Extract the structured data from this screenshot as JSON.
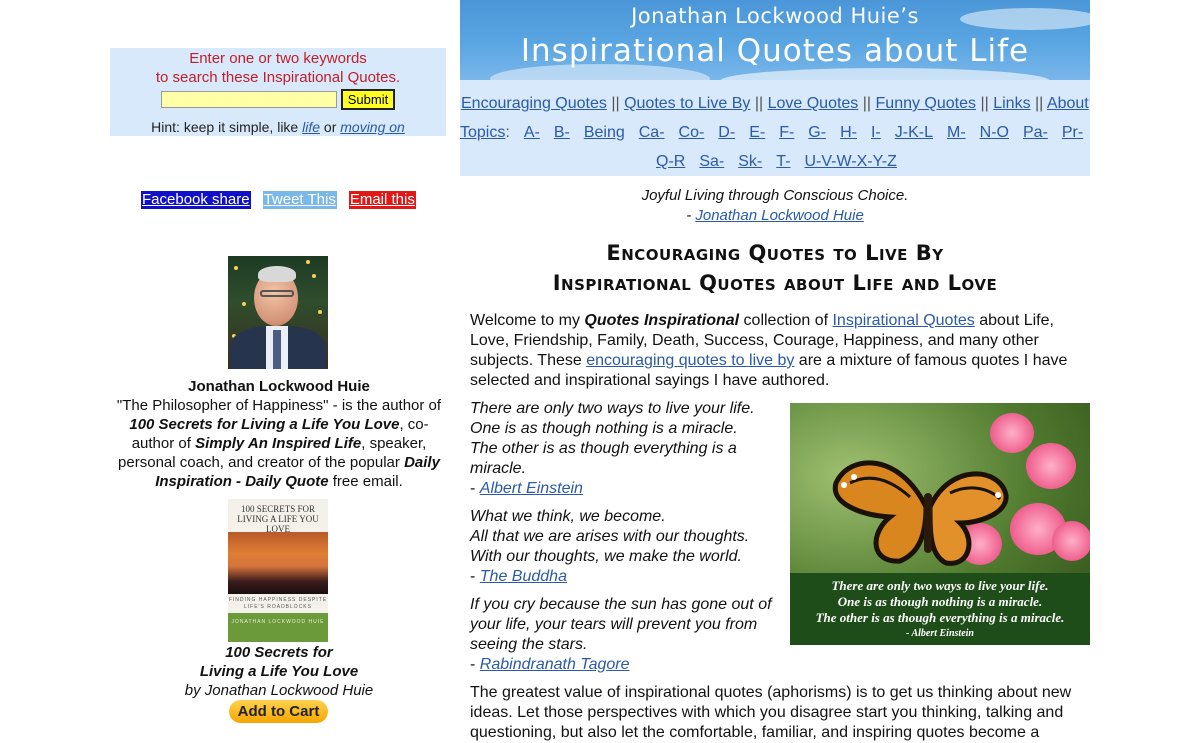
{
  "search": {
    "prompt_line1": "Enter one or two keywords",
    "prompt_line2": "to search these Inspirational Quotes.",
    "input_value": "",
    "submit_label": "Submit",
    "hint_prefix": "Hint: keep it simple, like ",
    "hint_example1": "life",
    "hint_or": " or ",
    "hint_example2": "moving on"
  },
  "share": {
    "facebook": "Facebook share",
    "tweet": "Tweet This",
    "email": "Email this"
  },
  "author": {
    "name": "Jonathan Lockwood Huie",
    "bio_1": "\"The Philosopher of Happiness\" - is the author of ",
    "bio_book1": "100 Secrets for Living a Life You Love",
    "bio_2": ", co-author of ",
    "bio_book2": "Simply An Inspired Life",
    "bio_3": ", speaker, personal coach, and creator of the popular ",
    "bio_product": "Daily Inspiration - Daily Quote",
    "bio_4": " free email."
  },
  "book": {
    "cover_title": "100 SECRETS FOR LIVING A LIFE YOU LOVE",
    "cover_subtitle": "FINDING HAPPINESS DESPITE LIFE'S ROADBLOCKS",
    "cover_author": "JONATHAN LOCKWOOD HUIE",
    "caption_line1": "100 Secrets for",
    "caption_line2": "Living a Life You Love",
    "caption_by": "by Jonathan Lockwood Huie",
    "cart_label": "Add to Cart"
  },
  "banner": {
    "top": "Jonathan Lockwood Huie’s",
    "main": "Inspirational Quotes about Life"
  },
  "nav": {
    "links": [
      "Encouraging Quotes",
      "Quotes to Live By",
      "Love Quotes",
      "Funny Quotes",
      "Links",
      "About"
    ],
    "separator": "||",
    "topics_label": "Topics",
    "topics_row1": [
      "A-",
      "B-",
      "Being",
      "Ca-",
      "Co-",
      "D-",
      "E-",
      "F-",
      "G-",
      "H-",
      "I-",
      "J-K-L",
      "M-",
      "N-O",
      "Pa-",
      "Pr-"
    ],
    "topics_row2": [
      "Q-R",
      "Sa-",
      "Sk-",
      "T-",
      "U-V-W-X-Y-Z"
    ]
  },
  "tagline": {
    "text": "Joyful Living through Conscious Choice.",
    "dash": "- ",
    "author": "Jonathan Lockwood Huie"
  },
  "heading": {
    "line1": "Encouraging Quotes to Live By",
    "line2": "Inspirational Quotes about Life and Love"
  },
  "intro": {
    "p1": "Welcome to my ",
    "bold": "Quotes Inspirational",
    "p2": " collection of ",
    "link1": "Inspirational Quotes",
    "p3": " about Life, Love, Friendship, Family, Death, Success, Courage, Happiness, and many other subjects. These ",
    "link2": "encouraging quotes to live by",
    "p4": " are a mixture of famous quotes I have selected and inspirational sayings I have authored."
  },
  "quotes": [
    {
      "lines": [
        "There are only two ways to live your life.",
        "One is as though nothing is a miracle.",
        "The other is as though everything is a",
        "miracle."
      ],
      "author": "Albert Einstein"
    },
    {
      "lines": [
        "What we think, we become.",
        "All that we are arises with our thoughts.",
        "With our thoughts, we make the world."
      ],
      "author": "The Buddha"
    },
    {
      "lines": [
        "If you cry because the sun has gone out of",
        "your life, your tears will prevent you from",
        "seeing the stars."
      ],
      "author": "Rabindranath Tagore"
    }
  ],
  "image_caption": {
    "lines": [
      "There are only two ways to live your life.",
      "One is as though nothing is a miracle.",
      "The other is as though everything is a miracle."
    ],
    "attribution": "- Albert Einstein"
  },
  "closing": {
    "text": "The greatest value of inspirational quotes (aphorisms) is to get us thinking about new ideas. Let those perspectives with which you disagree start you thinking, talking and questioning, but also let the comfortable, familiar, and inspiring quotes become a"
  },
  "colors": {
    "link": "#2a5aa8",
    "panel_bg": "#d8e9fb",
    "prompt_red": "#c0202a",
    "facebook_bg": "#1010c8",
    "tweet_bg": "#7ab8e8",
    "email_bg": "#e01818",
    "cart_yellow": "#f5a500"
  }
}
